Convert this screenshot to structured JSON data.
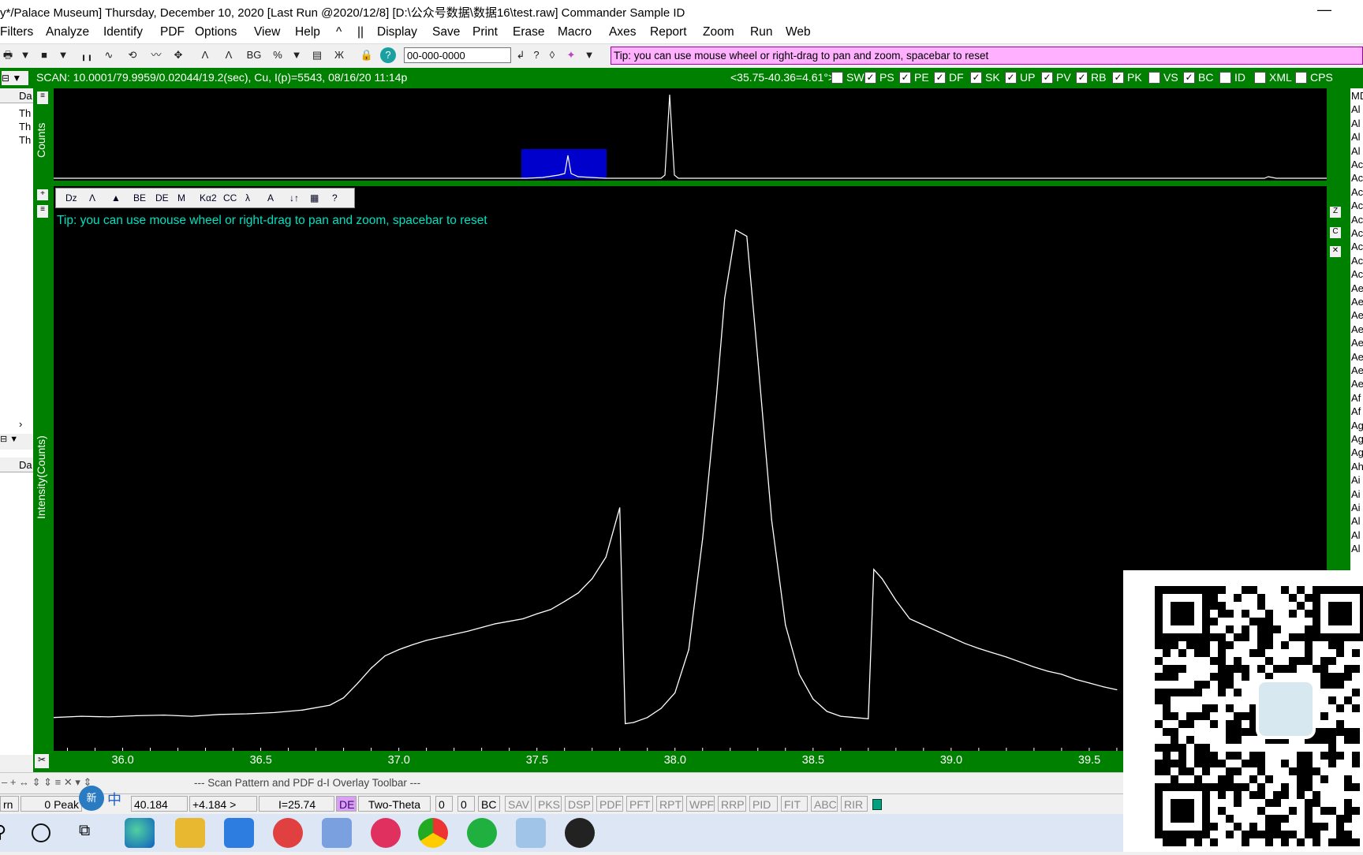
{
  "title": {
    "text": "y*/Palace Museum] Thursday, December 10, 2020 [Last Run @2020/12/8] [D:\\公众号数据\\数据16\\test.raw] Commander Sample ID",
    "minimize": "—"
  },
  "menu": [
    "Filters",
    "Analyze",
    "Identify",
    "PDF",
    "Options",
    "View",
    "Help",
    "^",
    "||",
    "Display",
    "Save",
    "Print",
    "Erase",
    "Macro",
    "Axes",
    "Report",
    "Zoom",
    "Run",
    "Web"
  ],
  "toolbar": {
    "id_value": "00-000-0000",
    "tip": "Tip: you can use mouse wheel or right-drag to pan and zoom, spacebar to reset"
  },
  "scan_info": "SCAN: 10.0001/79.9959/0.02044/19.2(sec), Cu, I(p)=5543, 08/16/20 11:14p",
  "range_readout": "<35.75-40.36=4.61°>",
  "flags": [
    {
      "label": "SW",
      "checked": false
    },
    {
      "label": "PS",
      "checked": true
    },
    {
      "label": "PE",
      "checked": true
    },
    {
      "label": "DF",
      "checked": true
    },
    {
      "label": "SK",
      "checked": true
    },
    {
      "label": "UP",
      "checked": true
    },
    {
      "label": "PV",
      "checked": true
    },
    {
      "label": "RB",
      "checked": true
    },
    {
      "label": "PK",
      "checked": true
    },
    {
      "label": "VS",
      "checked": false
    },
    {
      "label": "BC",
      "checked": true
    },
    {
      "label": "ID",
      "checked": false
    },
    {
      "label": "XML",
      "checked": false
    },
    {
      "label": "CPS",
      "checked": false
    }
  ],
  "overview_ylabel": "Counts",
  "plot_tip": "Tip: you can use mouse wheel or right-drag to pan and zoom, spacebar to reset",
  "plot_tools": [
    "Dz",
    "Λ",
    "▲",
    "BE",
    "DE",
    "M",
    "Kα2",
    "CC",
    "λ",
    "A",
    "↓↑",
    "▦",
    "?"
  ],
  "chart_data": {
    "type": "line",
    "title": "",
    "xlabel": "",
    "ylabel": "Intensity(Counts)",
    "xlim": [
      35.75,
      40.36
    ],
    "xticks": [
      "36.0",
      "36.5",
      "37.0",
      "37.5",
      "38.0",
      "38.5",
      "39.0",
      "39.5"
    ],
    "series": [
      {
        "x": [
          35.75,
          35.85,
          35.95,
          36.05,
          36.15,
          36.25,
          36.35,
          36.45,
          36.55,
          36.65,
          36.75,
          36.8,
          36.85,
          36.9,
          36.95,
          37.0,
          37.05,
          37.1,
          37.15,
          37.2,
          37.25,
          37.3,
          37.35,
          37.4,
          37.45,
          37.5,
          37.55,
          37.6,
          37.65,
          37.7,
          37.75,
          37.8,
          37.82,
          37.85,
          37.9,
          37.95,
          38.0,
          38.05,
          38.1,
          38.15,
          38.18,
          38.22,
          38.26,
          38.3,
          38.35,
          38.4,
          38.45,
          38.5,
          38.55,
          38.6,
          38.65,
          38.7,
          38.72,
          38.75,
          38.8,
          38.85,
          38.9,
          38.95,
          39.0,
          39.05,
          39.1,
          39.15,
          39.2,
          39.25,
          39.3,
          39.35,
          39.4,
          39.45,
          39.5,
          39.55,
          39.6
        ],
        "y": [
          40,
          42,
          41,
          43,
          44,
          42,
          45,
          46,
          48,
          52,
          60,
          72,
          95,
          120,
          140,
          150,
          158,
          165,
          170,
          175,
          180,
          186,
          192,
          196,
          200,
          208,
          215,
          228,
          242,
          265,
          300,
          380,
          30,
          32,
          40,
          55,
          80,
          150,
          330,
          560,
          720,
          830,
          820,
          620,
          360,
          190,
          110,
          70,
          50,
          42,
          40,
          38,
          280,
          265,
          230,
          200,
          190,
          180,
          170,
          160,
          152,
          145,
          138,
          130,
          122,
          115,
          110,
          102,
          96,
          90,
          85
        ]
      }
    ]
  },
  "bottom_toolbar_label": "--- Scan Pattern and PDF d-I Overlay Toolbar ---",
  "status": {
    "left": "rn",
    "peaks": "0 Peak",
    "x": "40.184",
    "d": "+4.184 >",
    "intensity": "I=25.74",
    "de": "DE",
    "mode": "Two-Theta",
    "c1": "0",
    "c2": "0",
    "bc": "BC",
    "buttons": [
      "SAV",
      "PKS",
      "DSP",
      "PDF",
      "PFT",
      "RPT",
      "WPF",
      "RRP",
      "PID",
      "FIT",
      "ABC",
      "RIR"
    ]
  },
  "ime": "中",
  "rightlist": [
    "MD",
    "Al",
    "Al",
    "Al",
    "Al",
    "Ac",
    "Ac",
    "Ac",
    "Ac",
    "Ac",
    "Ac",
    "Ac",
    "Ac",
    "Ac",
    "Ae",
    "Ae",
    "Ae",
    "Ae",
    "Ae",
    "Ae",
    "Ae",
    "Ae",
    "Af",
    "Af",
    "Ag",
    "Ag",
    "Ag",
    "Ah",
    "Ai",
    "Ai",
    "Ai",
    "Al",
    "Al",
    "Al"
  ],
  "leftpane": {
    "col": "Da",
    "rows": [
      "Th",
      "Th",
      "Th"
    ]
  }
}
